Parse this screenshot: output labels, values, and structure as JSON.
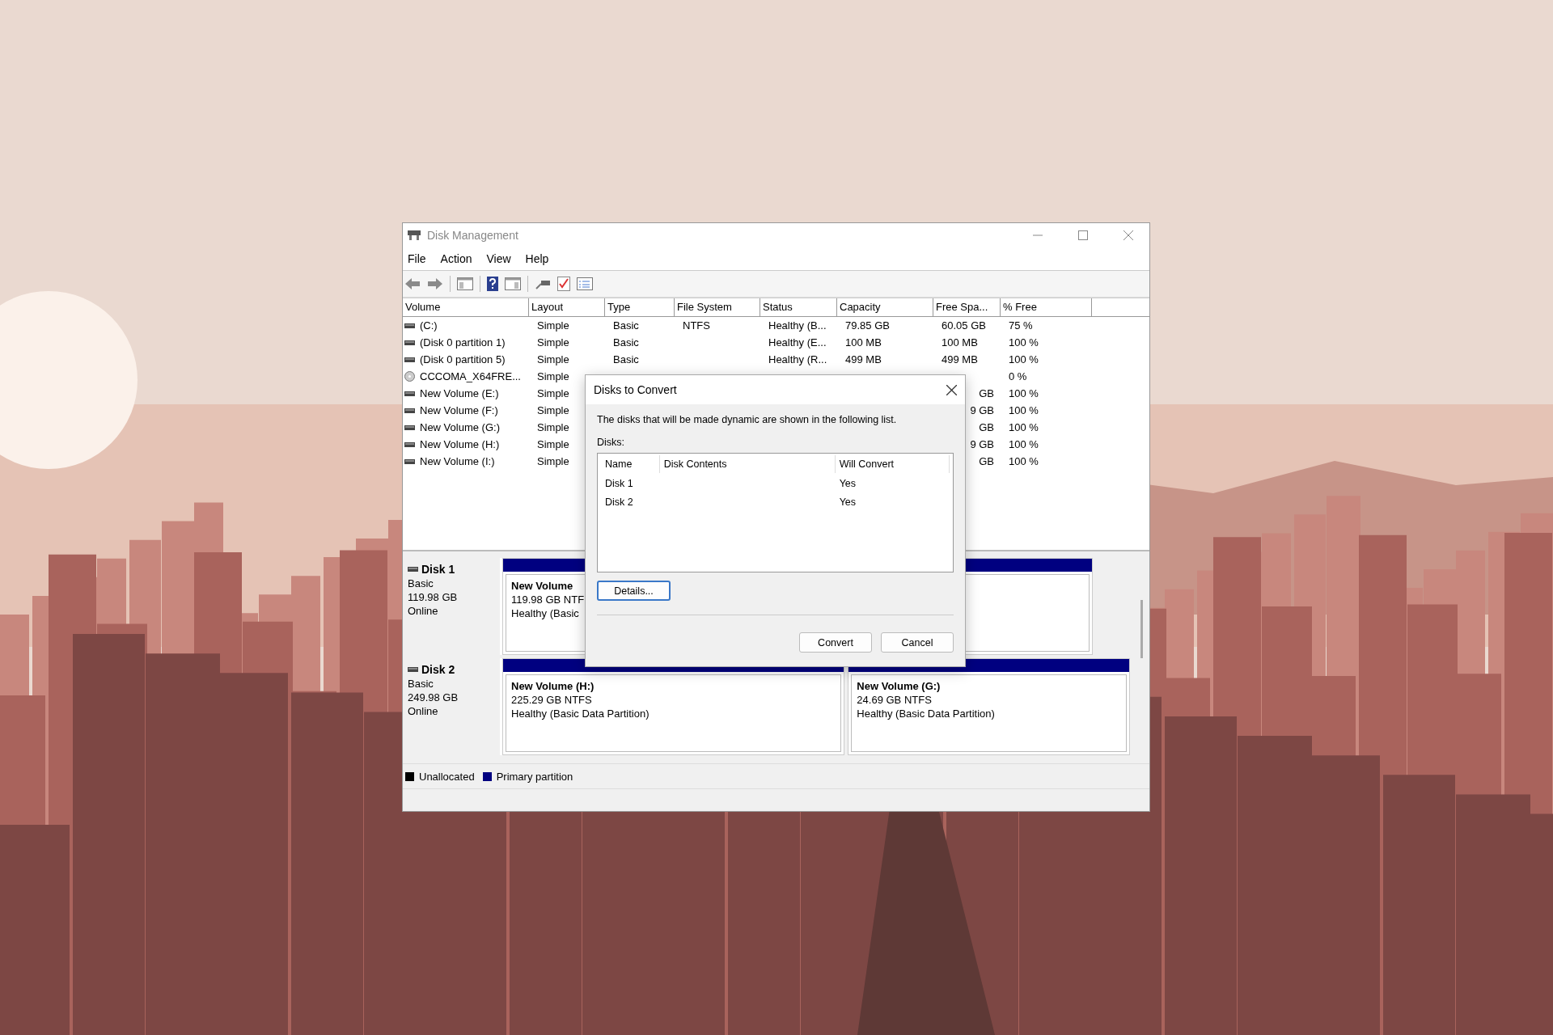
{
  "window": {
    "title": "Disk Management"
  },
  "menu": [
    "File",
    "Action",
    "View",
    "Help"
  ],
  "table": {
    "columns": [
      "Volume",
      "Layout",
      "Type",
      "File System",
      "Status",
      "Capacity",
      "Free Spa...",
      "% Free"
    ],
    "rows": [
      {
        "kind": "drive",
        "volume": "(C:)",
        "layout": "Simple",
        "type": "Basic",
        "file_system": "NTFS",
        "status": "Healthy (B...",
        "capacity": "79.85 GB",
        "free_space": "60.05 GB",
        "pct_free": "75 %"
      },
      {
        "kind": "drive",
        "volume": "(Disk 0 partition 1)",
        "layout": "Simple",
        "type": "Basic",
        "status": "Healthy (E...",
        "capacity": "100 MB",
        "free_space": "100 MB",
        "pct_free": "100 %"
      },
      {
        "kind": "drive",
        "volume": "(Disk 0 partition 5)",
        "layout": "Simple",
        "type": "Basic",
        "status": "Healthy (R...",
        "capacity": "499 MB",
        "free_space": "499 MB",
        "pct_free": "100 %"
      },
      {
        "kind": "optical",
        "volume": "CCCOMA_X64FRE...",
        "layout": "Simple",
        "pct_free": "0 %"
      },
      {
        "kind": "drive",
        "volume": "New Volume (E:)",
        "layout": "Simple",
        "free_space_tail": "GB",
        "pct_free": "100 %"
      },
      {
        "kind": "drive",
        "volume": "New Volume (F:)",
        "layout": "Simple",
        "free_space_tail": "9 GB",
        "pct_free": "100 %"
      },
      {
        "kind": "drive",
        "volume": "New Volume (G:)",
        "layout": "Simple",
        "free_space_tail": "GB",
        "pct_free": "100 %"
      },
      {
        "kind": "drive",
        "volume": "New Volume (H:)",
        "layout": "Simple",
        "free_space_tail": "9 GB",
        "pct_free": "100 %"
      },
      {
        "kind": "drive",
        "volume": "New Volume (I:)",
        "layout": "Simple",
        "free_space_tail": "GB",
        "pct_free": "100 %"
      }
    ]
  },
  "disks": [
    {
      "name": "Disk 1",
      "type": "Basic",
      "size": "119.98 GB",
      "status": "Online",
      "partitions": [
        {
          "name": "New Volume",
          "size": "119.98 GB NTF",
          "health": "Healthy (Basic"
        }
      ]
    },
    {
      "name": "Disk 2",
      "type": "Basic",
      "size": "249.98 GB",
      "status": "Online",
      "partitions": [
        {
          "name": "New Volume  (H:)",
          "size": "225.29 GB NTFS",
          "health": "Healthy (Basic Data Partition)"
        },
        {
          "name": "New Volume  (G:)",
          "size": "24.69 GB NTFS",
          "health": "Healthy (Basic Data Partition)"
        }
      ]
    }
  ],
  "legend": [
    {
      "label": "Unallocated",
      "color": "#000000"
    },
    {
      "label": "Primary partition",
      "color": "#000080"
    }
  ],
  "dialog": {
    "title": "Disks to Convert",
    "message": "The disks that will be made dynamic are shown in the following list.",
    "list_label": "Disks:",
    "columns": [
      "Name",
      "Disk Contents",
      "Will Convert"
    ],
    "rows": [
      {
        "name": "Disk 1",
        "will_convert": "Yes"
      },
      {
        "name": "Disk 2",
        "will_convert": "Yes"
      }
    ],
    "details_button": "Details...",
    "buttons": [
      "Convert",
      "Cancel"
    ]
  }
}
